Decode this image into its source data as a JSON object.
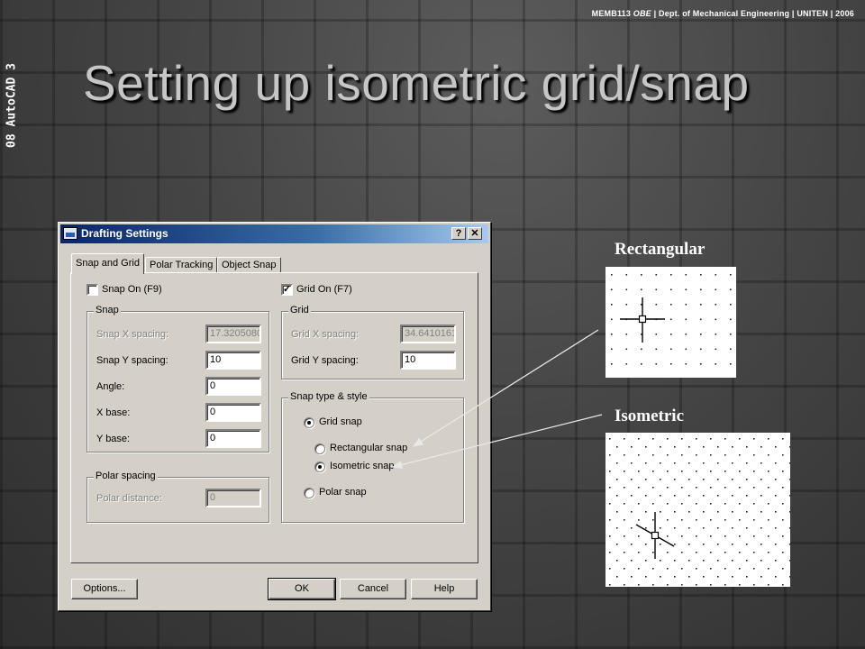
{
  "header": {
    "course": "MEMB113 ",
    "course_italic": "OBE",
    "rest": " | Dept. of Mechanical Engineering | UNITEN | 2006"
  },
  "side_label": "08 AutoCAD 3",
  "title": "Setting up isometric grid/snap",
  "dialog": {
    "title": "Drafting Settings",
    "help_glyph": "?",
    "close_glyph": "✕",
    "tabs": [
      "Snap and Grid",
      "Polar Tracking",
      "Object Snap"
    ],
    "snap_on": {
      "label": "Snap On (F9)",
      "checked": false
    },
    "grid_on": {
      "label": "Grid On (F7)",
      "checked": true,
      "mark": "✓"
    },
    "snap_group": {
      "title": "Snap",
      "fields": [
        {
          "label": "Snap X spacing:",
          "value": "17.3205080",
          "disabled": true
        },
        {
          "label": "Snap Y spacing:",
          "value": "10",
          "disabled": false
        },
        {
          "label": "Angle:",
          "value": "0",
          "disabled": false
        },
        {
          "label": "X base:",
          "value": "0",
          "disabled": false
        },
        {
          "label": "Y base:",
          "value": "0",
          "disabled": false
        }
      ]
    },
    "polar_group": {
      "title": "Polar spacing",
      "label": "Polar distance:",
      "value": "0"
    },
    "grid_group": {
      "title": "Grid",
      "fields": [
        {
          "label": "Grid X spacing:",
          "value": "34.6410161",
          "disabled": true
        },
        {
          "label": "Grid Y spacing:",
          "value": "10",
          "disabled": false
        }
      ]
    },
    "snap_type_group": {
      "title": "Snap type & style",
      "options": [
        {
          "label": "Grid snap",
          "checked": true
        },
        {
          "label": "Rectangular snap",
          "checked": false
        },
        {
          "label": "Isometric snap",
          "checked": true
        },
        {
          "label": "Polar snap",
          "checked": false
        }
      ]
    },
    "buttons": {
      "options": "Options...",
      "ok": "OK",
      "cancel": "Cancel",
      "help": "Help"
    }
  },
  "samples": {
    "rectangular_label": "Rectangular",
    "isometric_label": "Isometric"
  },
  "colors": {
    "title_text": "#c6c6c6",
    "titlebar_start": "#0a246a",
    "titlebar_end": "#a6caf0",
    "dialog_face": "#d4d0c8",
    "arrow_line": "#e8e8e8"
  }
}
